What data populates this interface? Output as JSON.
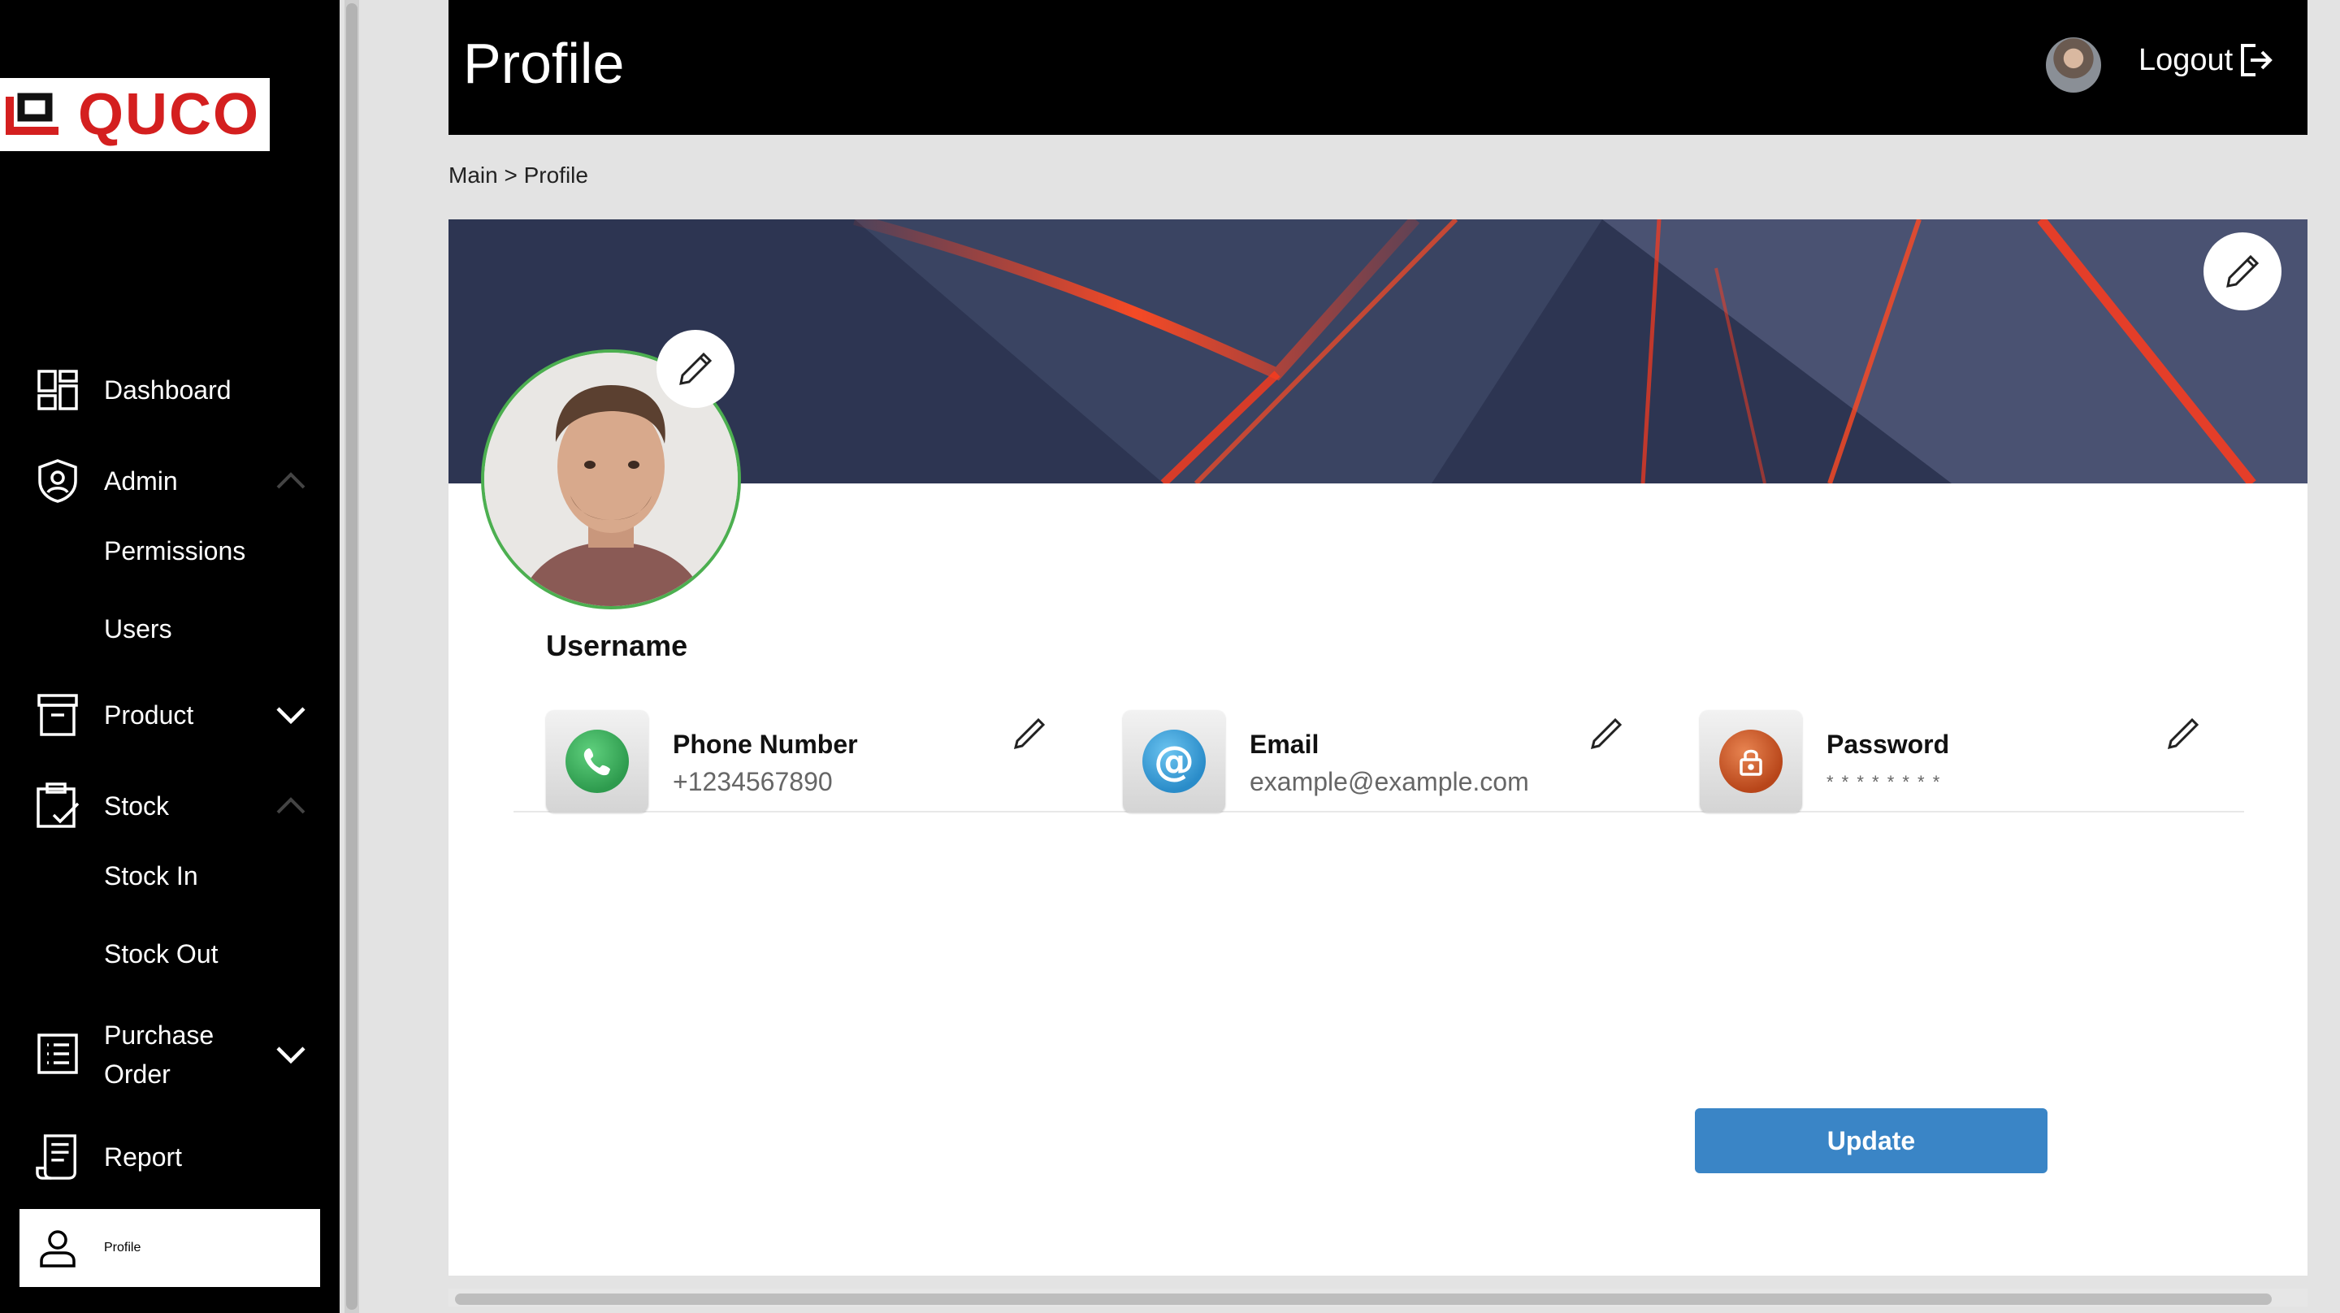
{
  "logo": {
    "text": "QUCO",
    "accent": "#d41f1f"
  },
  "sidebar": {
    "items": [
      {
        "label": "Dashboard",
        "icon": "dashboard-grid-icon"
      },
      {
        "label": "Admin",
        "icon": "shield-user-icon",
        "chevron": "chevron-up-icon"
      },
      {
        "label": "Permissions"
      },
      {
        "label": "Users"
      },
      {
        "label": "Product",
        "icon": "archive-box-icon",
        "chevron": "chevron-down-icon"
      },
      {
        "label": "Stock",
        "icon": "clipboard-check-icon",
        "chevron": "chevron-up-icon"
      },
      {
        "label": "Stock In"
      },
      {
        "label": "Stock Out"
      },
      {
        "label": "Purchase Order",
        "icon": "list-document-icon",
        "chevron": "chevron-down-icon"
      },
      {
        "label": "Report",
        "icon": "receipt-icon"
      },
      {
        "label": "Profile",
        "icon": "user-icon",
        "active": true
      }
    ]
  },
  "header": {
    "title": "Profile",
    "logout_label": "Logout"
  },
  "breadcrumb": "Main > Profile",
  "profile": {
    "username": "Username",
    "fields": [
      {
        "title": "Phone Number",
        "value": "+1234567890",
        "icon": "phone-icon",
        "color": "#2e9b4e"
      },
      {
        "title": "Email",
        "value": "example@example.com",
        "icon": "at-sign-icon",
        "color": "#2a8cc9"
      },
      {
        "title": "Password",
        "value": "* * * * * * * *",
        "icon": "lock-icon",
        "color": "#c0501c"
      }
    ],
    "update_label": "Update"
  },
  "colors": {
    "accent": "#3a85c6",
    "avatar_border": "#4caf50",
    "header_bg": "#000000"
  }
}
